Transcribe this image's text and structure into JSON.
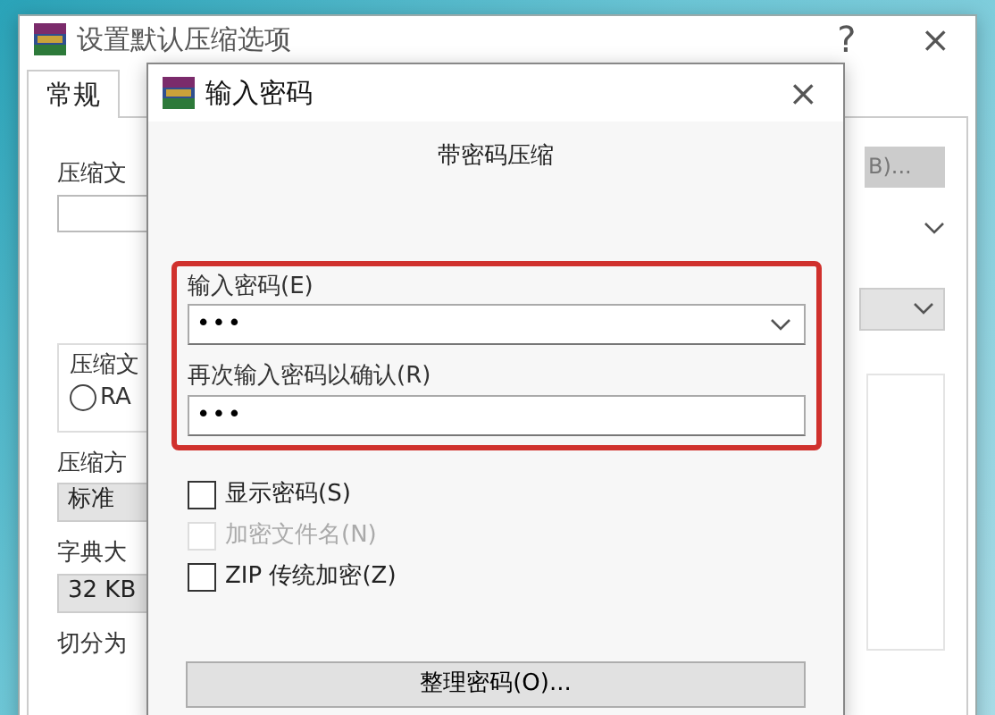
{
  "main_window": {
    "title": "设置默认压缩选项",
    "help_button": "?",
    "close_button": "×",
    "tabs": [
      {
        "label": "常规",
        "selected": true
      }
    ],
    "archive_name_label": "压缩文",
    "format_group": {
      "label": "压缩文",
      "radio": {
        "label": "RA",
        "selected": false
      }
    },
    "method_label": "压缩方",
    "method_value": "标准",
    "dictionary_label": "字典大",
    "dictionary_value": "32 KB",
    "split_label": "切分为",
    "browse_button": "B)..."
  },
  "password_dialog": {
    "title": "输入密码",
    "close_button": "×",
    "heading": "带密码压缩",
    "password_label": "输入密码(E)",
    "password_value": "•••",
    "confirm_label": "再次输入密码以确认(R)",
    "confirm_value": "•••",
    "options": [
      {
        "label": "显示密码(S)",
        "checked": false,
        "disabled": false
      },
      {
        "label": "加密文件名(N)",
        "checked": false,
        "disabled": true
      },
      {
        "label": "ZIP 传统加密(Z)",
        "checked": false,
        "disabled": false
      }
    ],
    "manage_button": "整理密码(O)..."
  }
}
